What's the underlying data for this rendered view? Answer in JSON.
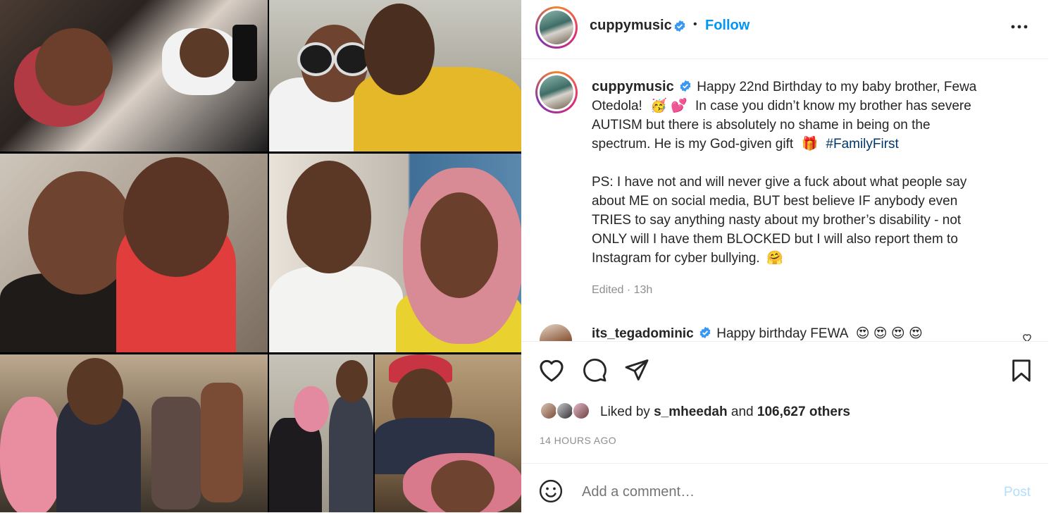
{
  "post": {
    "username": "cuppymusic",
    "follow_label": "Follow",
    "separator": "•",
    "more_label": "•••",
    "caption_lines": [
      "Happy 22nd Birthday to my baby brother, Fewa",
      "Otedola!",
      "In case you didn’t know my brother has severe",
      "AUTISM but there is absolutely no shame in being on the",
      "spectrum. He is my God-given gift",
      "#FamilyFirst"
    ],
    "emoji": {
      "party_face": "🥳",
      "two_hearts": "💕",
      "gift": "🎁",
      "hug": "🤗"
    },
    "ps_lines": [
      "PS: I have not and will never give a fuck about what people say",
      "about ME on social media, BUT best believe IF anybody even",
      "TRIES to say anything nasty about my brother’s disability - not",
      "ONLY will I have them BLOCKED but I will also report them to",
      "Instagram for cyber bullying."
    ],
    "edited": "Edited",
    "edited_sep": "·",
    "edited_time": "13h",
    "likes_prefix": "Liked by",
    "likes_user": "s_mheedah",
    "likes_and": "and",
    "likes_others": "106,627 others",
    "posted_ago": "14 HOURS AGO"
  },
  "comments": [
    {
      "username": "its_tegadominic",
      "text": "Happy birthday FEWA",
      "emoji": "😍 😍 😍 😍"
    }
  ],
  "comment_box": {
    "placeholder": "Add a comment…",
    "post_label": "Post"
  },
  "colors": {
    "link_blue": "#0095f6",
    "post_disabled": "#b2dffc",
    "hashtag": "#00376b",
    "muted": "#8e8e8e",
    "text": "#262626"
  },
  "icons": [
    "verified-badge-icon",
    "more-options-icon",
    "heart-icon",
    "comment-icon",
    "share-icon",
    "bookmark-icon",
    "emoji-icon"
  ]
}
